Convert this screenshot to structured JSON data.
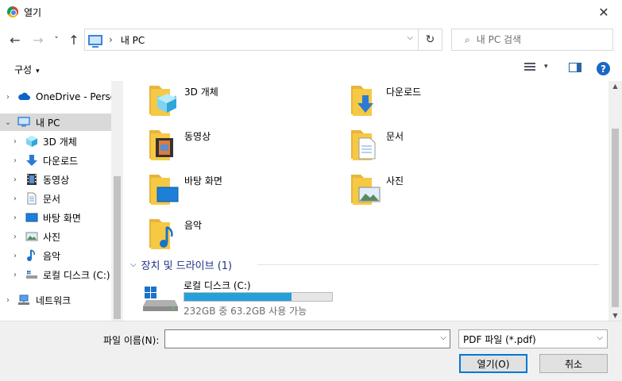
{
  "window": {
    "title": "열기",
    "close_glyph": "✕"
  },
  "nav": {
    "back_glyph": "←",
    "forward_glyph": "→",
    "recent_glyph": "˅",
    "up_glyph": "↑",
    "address_sep": "›",
    "address_path": "내 PC",
    "address_dropdown_glyph": "⌵",
    "refresh_glyph": "↻",
    "search_icon": "⌕",
    "search_placeholder": "내 PC 검색"
  },
  "commandbar": {
    "organize_label": "구성",
    "caret": "▾",
    "help_glyph": "?"
  },
  "tree": [
    {
      "label": "OneDrive - Persor",
      "icon": "cloud-icon",
      "arrow": "›",
      "level": 0
    },
    {
      "label": "내 PC",
      "icon": "pc-icon",
      "arrow": "⌄",
      "level": 0,
      "selected": true
    },
    {
      "label": "3D 개체",
      "icon": "3d-objects-icon",
      "arrow": "›",
      "level": 1
    },
    {
      "label": "다운로드",
      "icon": "download-icon",
      "arrow": "›",
      "level": 1
    },
    {
      "label": "동영상",
      "icon": "video-icon",
      "arrow": "›",
      "level": 1
    },
    {
      "label": "문서",
      "icon": "document-icon",
      "arrow": "›",
      "level": 1
    },
    {
      "label": "바탕 화면",
      "icon": "desktop-icon",
      "arrow": "›",
      "level": 1
    },
    {
      "label": "사진",
      "icon": "pictures-icon",
      "arrow": "›",
      "level": 1
    },
    {
      "label": "음악",
      "icon": "music-icon",
      "arrow": "›",
      "level": 1
    },
    {
      "label": "로컬 디스크 (C:)",
      "icon": "drive-icon",
      "arrow": "›",
      "level": 1
    },
    {
      "label": "네트워크",
      "icon": "network-icon",
      "arrow": "›",
      "level": 0
    }
  ],
  "folders": [
    {
      "label": "3D 개체",
      "icon": "3d-objects-folder-icon"
    },
    {
      "label": "다운로드",
      "icon": "download-folder-icon"
    },
    {
      "label": "동영상",
      "icon": "video-folder-icon"
    },
    {
      "label": "문서",
      "icon": "document-folder-icon"
    },
    {
      "label": "바탕 화면",
      "icon": "desktop-folder-icon"
    },
    {
      "label": "사진",
      "icon": "pictures-folder-icon"
    },
    {
      "label": "음악",
      "icon": "music-folder-icon"
    }
  ],
  "devices": {
    "header": "장치 및 드라이브 (1)",
    "caret": "⌵",
    "drives": [
      {
        "label": "로컬 디스크 (C:)",
        "usage_fraction": 0.727,
        "free_text": "232GB 중 63.2GB 사용 가능"
      }
    ]
  },
  "bottom": {
    "filename_label": "파일 이름(N):",
    "filename_value": "",
    "dropdown_glyph": "⌵",
    "filetype_selected": "PDF 파일 (*.pdf)",
    "open_label": "열기(O)",
    "cancel_label": "취소"
  },
  "colors": {
    "accent": "#0078d7",
    "section_header": "#1e3287",
    "usage_bar": "#26a0da",
    "folder": "#f6c945"
  }
}
